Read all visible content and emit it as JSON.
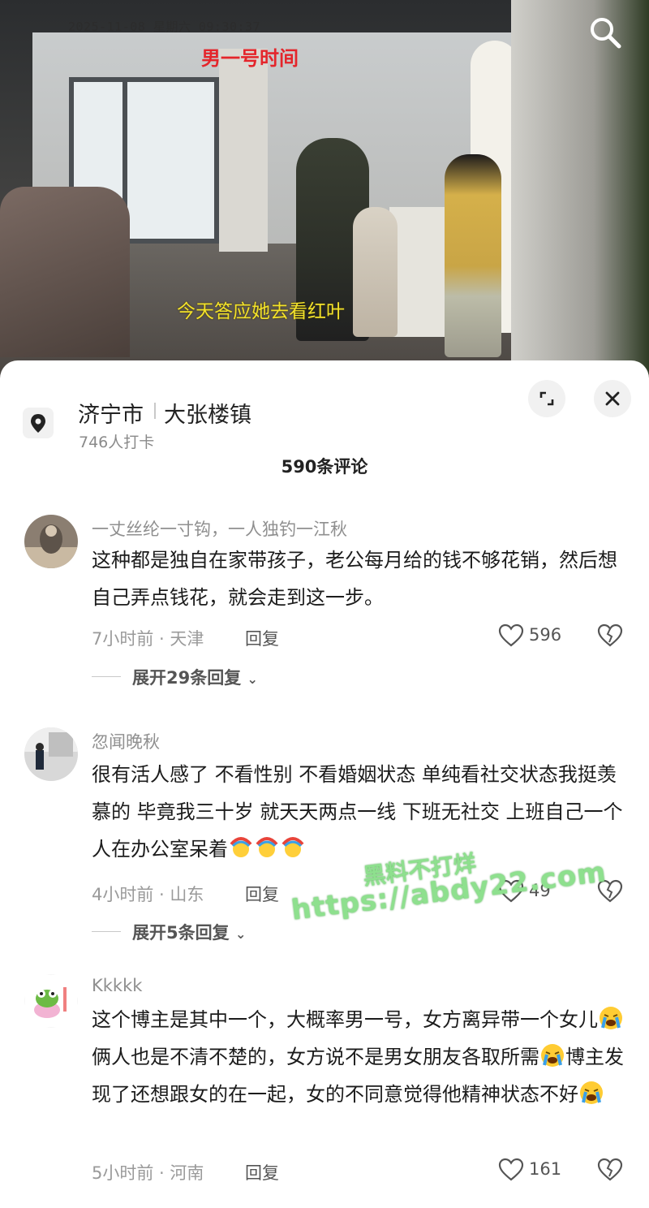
{
  "video": {
    "timestamp": "2025-11-08 星期六 09:30:37",
    "red_caption": "男一号时间",
    "yellow_caption": "今天答应她去看红叶",
    "search_icon": "search-icon"
  },
  "location": {
    "city": "济宁市",
    "town": "大张楼镇",
    "checkins": "746人打卡",
    "icons": {
      "pin": "location-pin-icon",
      "expand": "expand-icon",
      "close": "close-icon"
    }
  },
  "comment_count": "590条评论",
  "comments": [
    {
      "name": "一丈丝纶一寸钩，一人独钓一江秋",
      "text": "这种都是独自在家带孩子，老公每月给的钱不够花销，然后想自己弄点钱花，就会走到这一步。",
      "meta": "7小时前 · 天津",
      "reply_label": "回复",
      "likes": "596",
      "expand_label": "展开29条回复"
    },
    {
      "name": "忽闻晚秋",
      "text": "很有活人感了 不看性别 不看婚姻状态 单纯看社交状态我挺羡慕的 毕竟我三十岁 就天天两点一线 下班无社交 上班自己一个人在办公室呆着",
      "meta": "4小时前 · 山东",
      "reply_label": "回复",
      "likes": "49",
      "expand_label": "展开5条回复"
    },
    {
      "name": "Kkkkk",
      "text_parts": [
        "这个博主是其中一个，大概率男一号，女方离异带一个女儿",
        "俩人也是不清不楚的，女方说不是男女朋友各取所需",
        "博主发现了还想跟女的在一起，女的不同意觉得他精神状态不好"
      ],
      "meta": "5小时前 · 河南",
      "reply_label": "回复",
      "likes": "161"
    }
  ],
  "watermark": {
    "line1": "黑料不打烊",
    "line2": "https://abdy22.com"
  },
  "colors": {
    "red_caption": "#e4252b",
    "yellow_caption": "#f3e22b",
    "watermark": "#8ee08e"
  }
}
